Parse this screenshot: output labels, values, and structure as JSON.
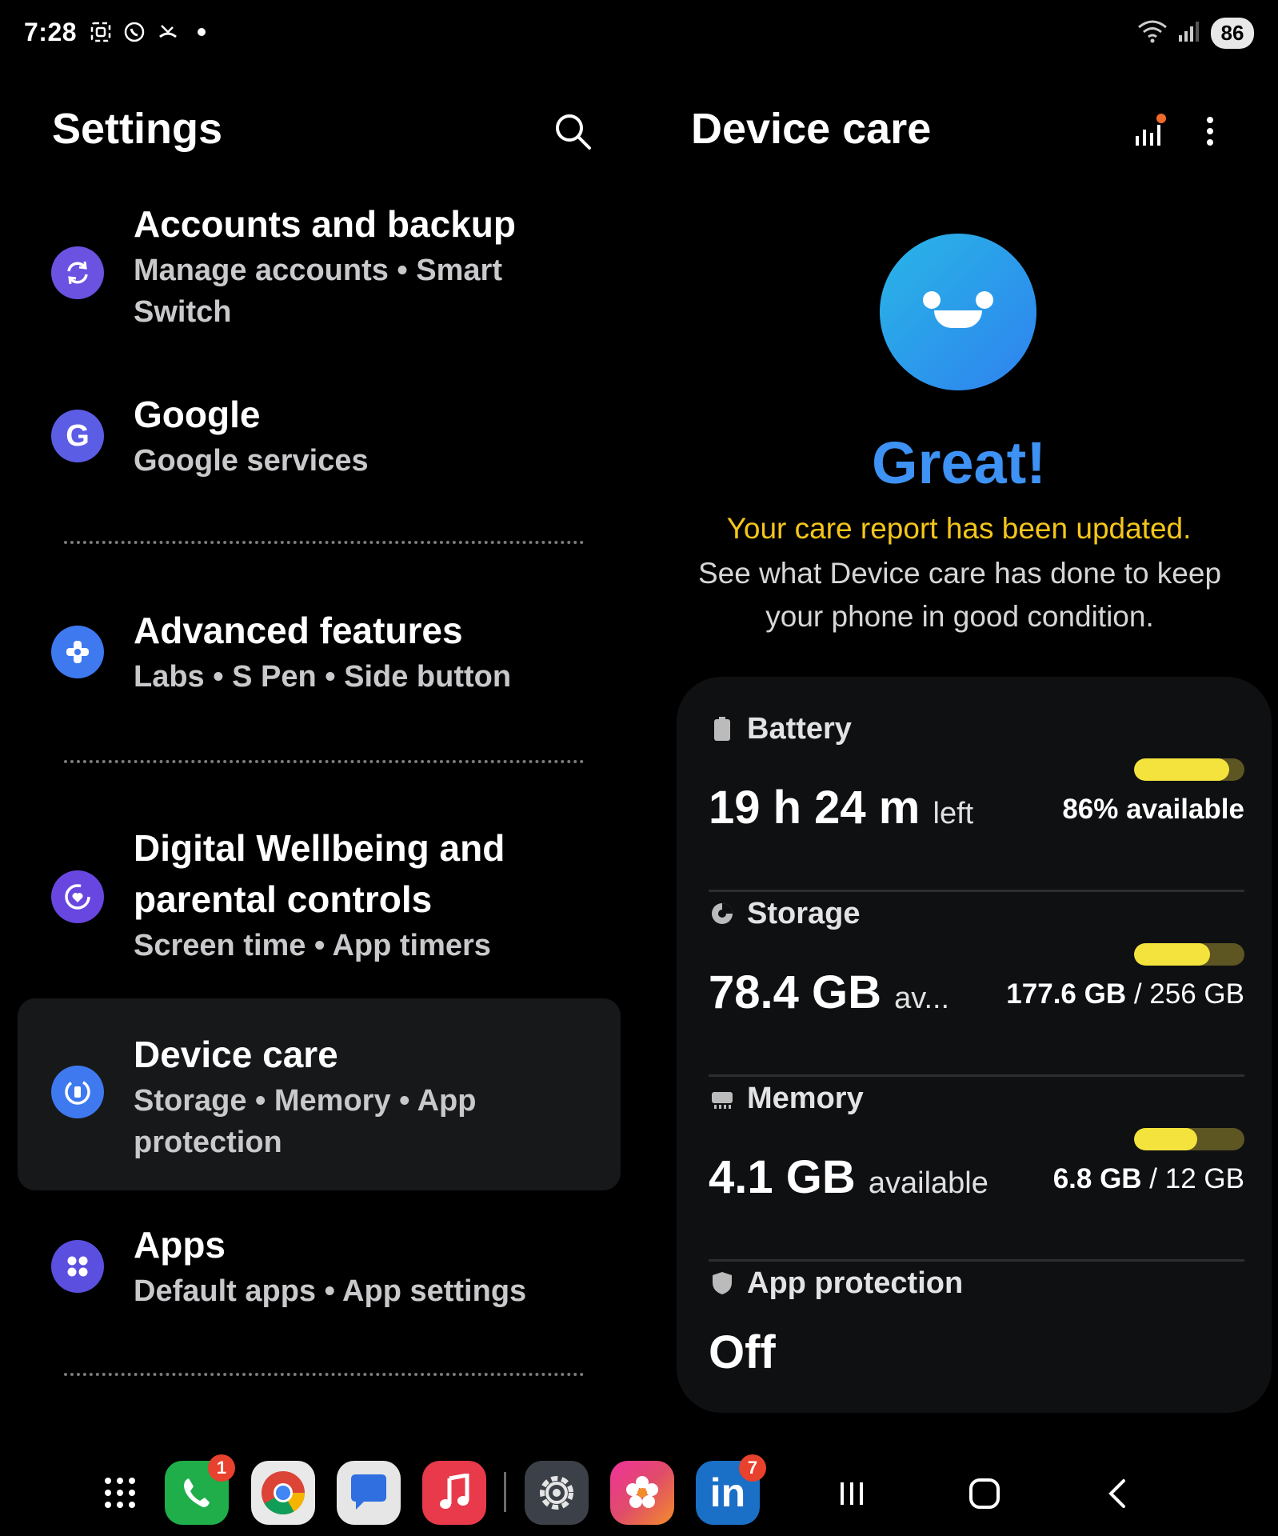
{
  "status_bar": {
    "time": "7:28",
    "battery": "86"
  },
  "settings": {
    "title": "Settings",
    "items": [
      {
        "title": "Accounts and backup",
        "subtitle": "Manage accounts  •  Smart Switch",
        "icon": "sync-icon",
        "color": "#6b52e0"
      },
      {
        "title": "Google",
        "subtitle": "Google services",
        "icon": "google-icon",
        "color": "#5b5de4"
      },
      {
        "title": "Advanced features",
        "subtitle": "Labs  •  S Pen  •  Side button",
        "icon": "advanced-features-icon",
        "color": "#3e79f0"
      },
      {
        "title": "Digital Wellbeing and parental controls",
        "subtitle": "Screen time  •  App timers",
        "icon": "wellbeing-icon",
        "color": "#6847e0"
      },
      {
        "title": "Device care",
        "subtitle": "Storage  •  Memory  •  App protection",
        "icon": "device-care-icon",
        "color": "#3e79f0"
      },
      {
        "title": "Apps",
        "subtitle": "Default apps  •  App settings",
        "icon": "apps-icon",
        "color": "#5b4fe0"
      }
    ]
  },
  "device_care": {
    "title": "Device care",
    "status": "Great!",
    "report_highlight": "Your care report has been updated.",
    "report_body": "See what Device care has done to keep your phone in good condition.",
    "battery": {
      "label": "Battery",
      "value": "19 h 24 m",
      "suffix": "left",
      "detail": "86% available",
      "fill": 0.86
    },
    "storage": {
      "label": "Storage",
      "value": "78.4 GB",
      "suffix": "av...",
      "used": "177.6 GB",
      "sep": " / ",
      "total": "256 GB",
      "fill": 0.69
    },
    "memory": {
      "label": "Memory",
      "value": "4.1 GB",
      "suffix": "available",
      "used": "6.8 GB",
      "sep": " / ",
      "total": "12 GB",
      "fill": 0.57
    },
    "app_protection": {
      "label": "App protection",
      "value": "Off"
    }
  },
  "dock": {
    "apps": [
      {
        "name": "apps-drawer",
        "badge": ""
      },
      {
        "name": "phone",
        "badge": "1"
      },
      {
        "name": "chrome",
        "badge": ""
      },
      {
        "name": "messages",
        "badge": ""
      },
      {
        "name": "music",
        "badge": ""
      },
      {
        "name": "settings",
        "badge": ""
      },
      {
        "name": "gallery",
        "badge": ""
      },
      {
        "name": "linkedin",
        "badge": "7"
      }
    ]
  },
  "colors": {
    "accent_blue": "#3d92f4",
    "highlight_yellow": "#f4c61a",
    "bar_yellow": "#f4e33c"
  }
}
